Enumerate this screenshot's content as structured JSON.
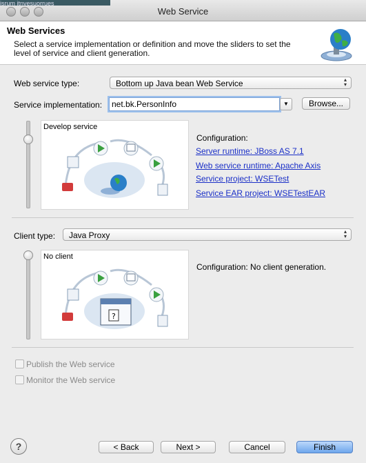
{
  "window": {
    "title": "Web Service",
    "background_snippet": "jsrum jtnvesuorrues"
  },
  "header": {
    "title": "Web Services",
    "description": "Select a service implementation or definition and move the sliders to set the level of service and client generation."
  },
  "service": {
    "type_label": "Web service type:",
    "type_value": "Bottom up Java bean Web Service",
    "impl_label": "Service implementation:",
    "impl_value": "net.bk.PersonInfo",
    "browse_label": "Browse...",
    "slider_level": "Develop service",
    "config_heading": "Configuration:",
    "links": {
      "server_runtime": "Server runtime: JBoss AS 7.1",
      "ws_runtime": "Web service runtime: Apache Axis",
      "project": "Service project: WSETest",
      "ear_project": "Service EAR project: WSETestEAR"
    }
  },
  "client": {
    "type_label": "Client type:",
    "type_value": "Java Proxy",
    "slider_level": "No client",
    "config_text": "Configuration: No client generation."
  },
  "options": {
    "publish": "Publish the Web service",
    "monitor": "Monitor the Web service"
  },
  "footer": {
    "help": "?",
    "back": "< Back",
    "next": "Next >",
    "cancel": "Cancel",
    "finish": "Finish"
  },
  "colors": {
    "link": "#1a2fc7",
    "finish_button": "#6ea6ec"
  }
}
